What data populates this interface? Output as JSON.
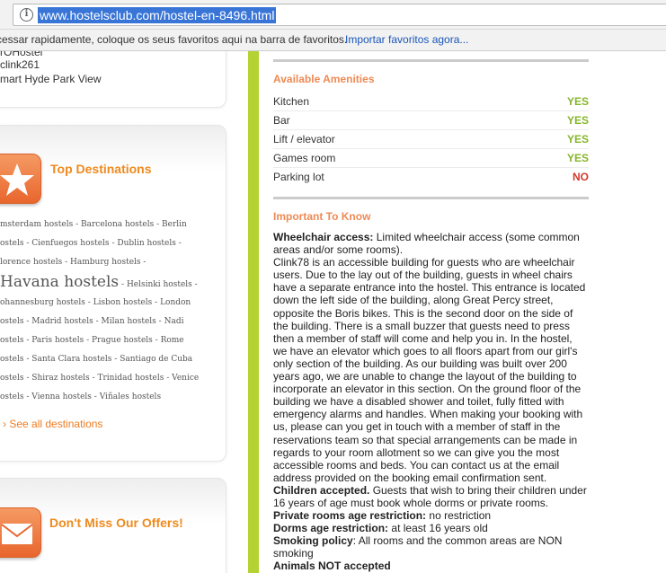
{
  "browser": {
    "url": "www.hostelsclub.com/hostel-en-8496.html",
    "bookmarks_bar_text": "cessar rapidamente, coloque os seus favoritos aqui na barra de favoritos.",
    "bookmarks_bar_link": "Importar favoritos agora..."
  },
  "sidebar": {
    "previous_lines": [
      "rOHostel",
      "clink261",
      "mart Hyde Park View"
    ],
    "top_destinations": {
      "title": "Top Destinations",
      "icon": "star-icon",
      "lines": [
        [
          "msterdam hostels",
          "Barcelona hostels",
          "Berlin"
        ],
        [
          "ostels",
          "Cienfuegos hostels",
          "Dublin hostels",
          ""
        ],
        [
          "lorence hostels",
          "Hamburg hostels",
          ""
        ],
        [
          "Havana hostels",
          "Helsinki hostels",
          ""
        ],
        [
          "ohannesburg hostels",
          "Lisbon hostels",
          "London"
        ],
        [
          "ostels",
          "Madrid hostels",
          "Milan hostels",
          "Nadi"
        ],
        [
          "ostels",
          "Paris hostels",
          "Prague hostels",
          "Rome"
        ],
        [
          "ostels",
          "Santa Clara hostels",
          "Santiago de Cuba"
        ],
        [
          "ostels",
          "Shiraz hostels",
          "Trinidad hostels",
          "Venice"
        ],
        [
          "ostels",
          "Vienna hostels",
          "Viñales hostels"
        ]
      ],
      "see_all": "See all destinations"
    },
    "offers": {
      "title": "Don't Miss Our Offers!",
      "icon": "envelope-icon"
    }
  },
  "amenities": {
    "title": "Available Amenities",
    "rows": [
      {
        "label": "Kitchen",
        "value": "YES"
      },
      {
        "label": "Bar",
        "value": "YES"
      },
      {
        "label": "Lift / elevator",
        "value": "YES"
      },
      {
        "label": "Games room",
        "value": "YES"
      },
      {
        "label": "Parking lot",
        "value": "NO"
      }
    ]
  },
  "important": {
    "title": "Important To Know",
    "wheelchair_label": "Wheelchair access:",
    "wheelchair_text": "Limited wheelchair access (some common areas and/or some rooms).",
    "description": "Clink78 is an accessible building for guests who are wheelchair users. Due to the lay out of the building, guests in wheel chairs have a separate entrance into the hostel. This entrance is located down the left side of the building, along Great Percy street, opposite the Boris bikes. This is the second door on the side of the building. There is a small buzzer that guests need to press then a member of staff will come and help you in. In the hostel, we have an elevator which goes to all floors apart from our girl's only section of the building. As our building was built over 200 years ago, we are unable to change the layout of the building to incorporate an elevator in this section. On the ground floor of the building we have a disabled shower and toilet, fully fitted with emergency alarms and handles. When making your booking with us, please can you get in touch with a member of staff in the reservations team so that special arrangements can be made in regards to your room allotment so we can give you the most accessible rooms and beds. You can contact us at the email address provided on the booking email confirmation sent.",
    "children_label": "Children accepted.",
    "children_text": "Guests that wish to bring their children under 16 years of age must book whole dorms or private rooms.",
    "private_label": "Private rooms age restriction:",
    "private_text": "no restriction",
    "dorms_label": "Dorms age restriction:",
    "dorms_text": "at least 16 years old",
    "smoking_label": "Smoking policy",
    "smoking_text": ": All rooms and the common areas are NON smoking",
    "animals_label": "Animals NOT accepted"
  },
  "colors": {
    "accent_orange": "#ee8a1e",
    "green_bar": "#b4d333",
    "yes": "#86b52a",
    "no": "#d23a2b"
  }
}
